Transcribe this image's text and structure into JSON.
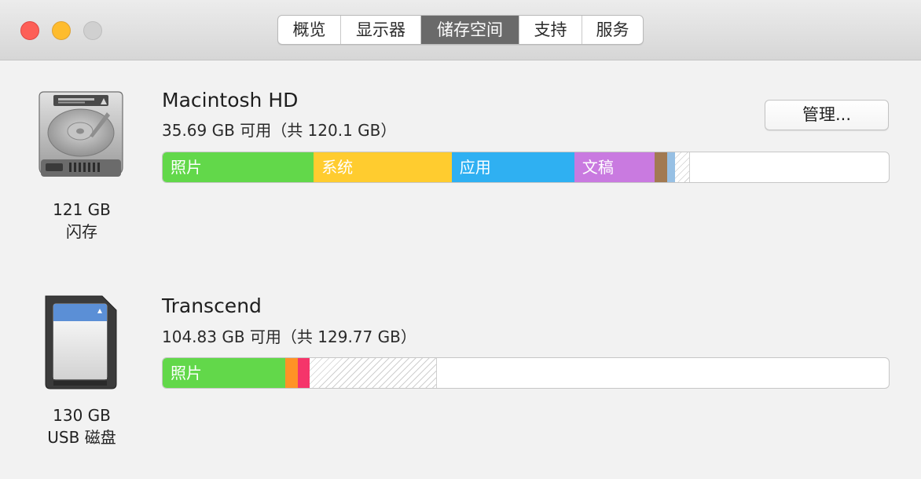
{
  "tabs": [
    {
      "label": "概览"
    },
    {
      "label": "显示器"
    },
    {
      "label": "储存空间",
      "active": true
    },
    {
      "label": "支持"
    },
    {
      "label": "服务"
    }
  ],
  "colors": {
    "photos": "#62d84a",
    "system": "#ffcc2f",
    "apps": "#2fb0f2",
    "documents": "#c97ae0",
    "other_brown": "#a27a52",
    "other_blue": "#97c0e4",
    "orange": "#ff9326",
    "pink": "#f5356a"
  },
  "disks": [
    {
      "icon": "hard-drive-icon",
      "caption_size": "121 GB",
      "caption_type": "闪存",
      "name": "Macintosh HD",
      "availability": "35.69 GB 可用（共 120.1 GB）",
      "manage_label": "管理...",
      "usage": [
        {
          "label": "照片",
          "fraction": 0.208
        },
        {
          "label": "系统",
          "fraction": 0.19
        },
        {
          "label": "应用",
          "fraction": 0.169
        },
        {
          "label": "文稿",
          "fraction": 0.111
        },
        {
          "label": "",
          "fraction": 0.017
        },
        {
          "label": "",
          "fraction": 0.007
        },
        {
          "label": "",
          "fraction": 0.02
        }
      ]
    },
    {
      "icon": "sd-card-icon",
      "caption_size": "130 GB",
      "caption_type": "USB 磁盘",
      "name": "Transcend",
      "availability": "104.83 GB 可用（共 129.77 GB）",
      "usage": [
        {
          "label": "照片",
          "fraction": 0.169
        },
        {
          "label": "",
          "fraction": 0.017
        },
        {
          "label": "",
          "fraction": 0.016
        },
        {
          "label": "",
          "fraction": 0.176
        }
      ]
    }
  ]
}
